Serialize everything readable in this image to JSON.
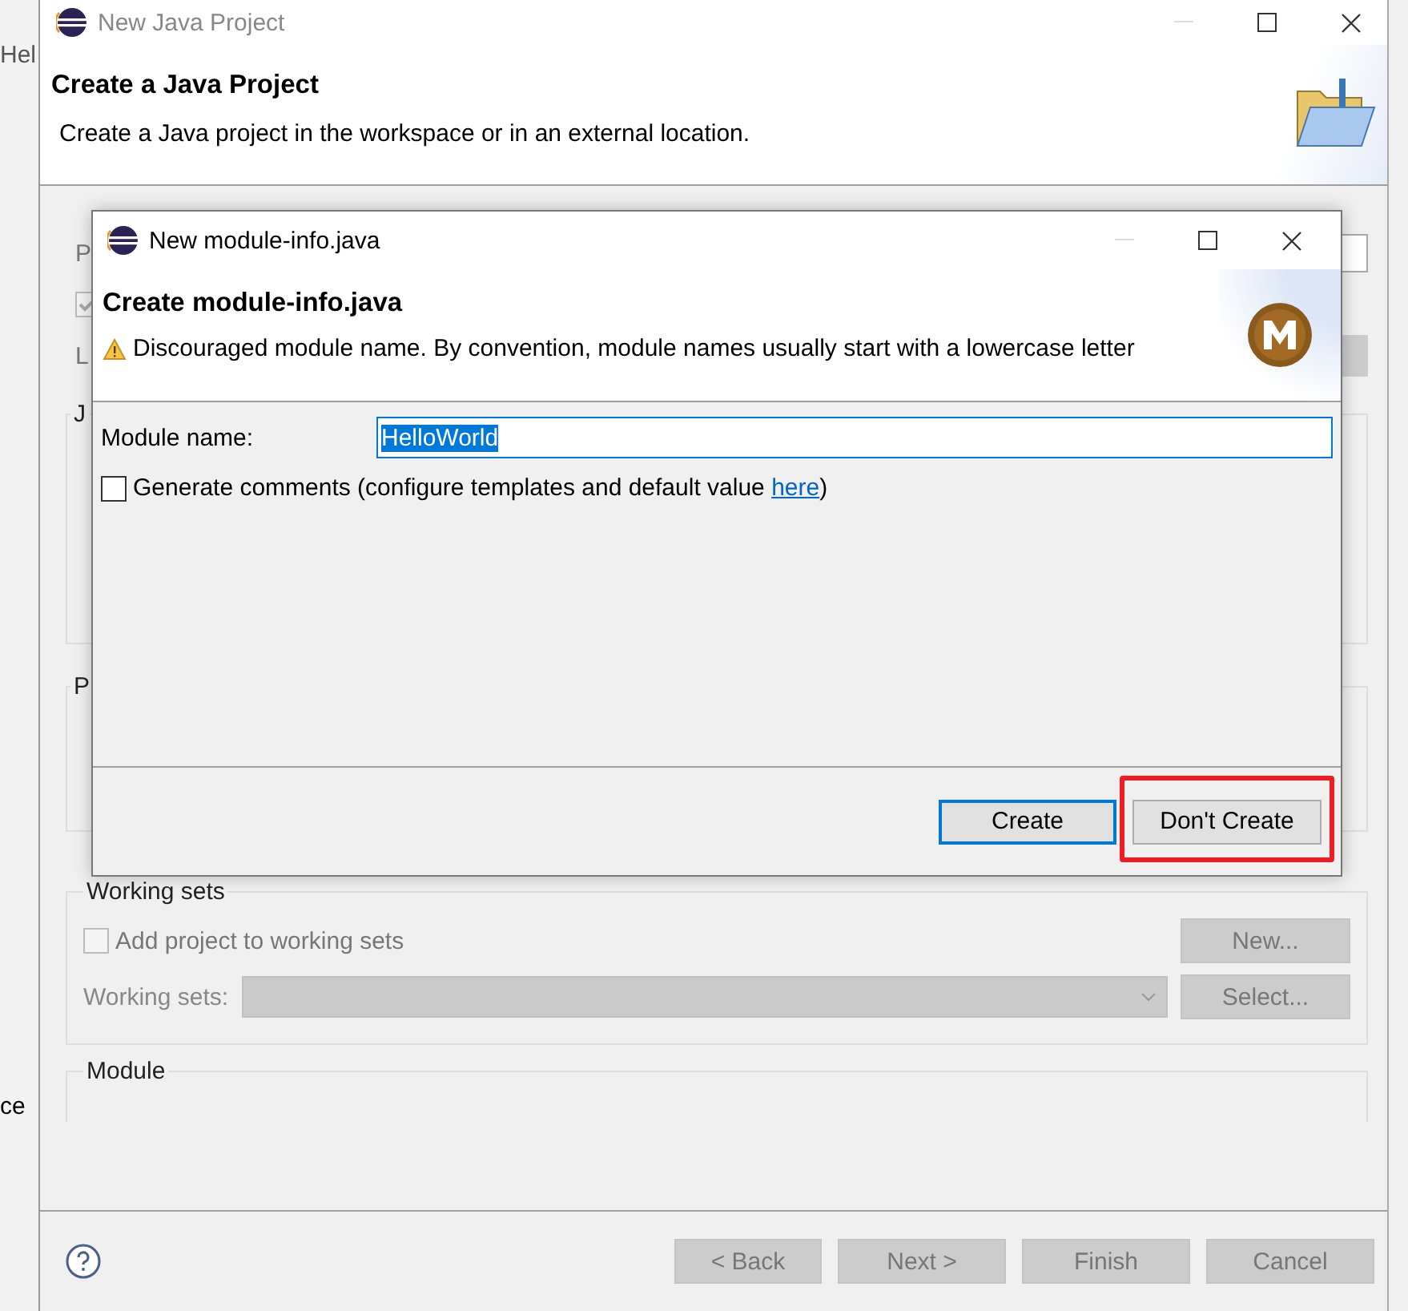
{
  "background": {
    "menu_fragment": "Hel",
    "side_fragment": "ce"
  },
  "window": {
    "title": "New Java Project",
    "heading": "Create a Java Project",
    "description": "Create a Java project in the workspace or in an external location."
  },
  "hidden_fragments": [
    "P",
    "L",
    "J",
    "P"
  ],
  "hidden_checkbox": {
    "checked": true,
    "disabled": true
  },
  "working_sets": {
    "title": "Working sets",
    "add_checkbox": {
      "label": "Add project to working sets",
      "checked": false,
      "disabled": true
    },
    "new_button": "New...",
    "sets_label": "Working sets:",
    "select_button": "Select..."
  },
  "module_group": {
    "title": "Module"
  },
  "footer": {
    "buttons": [
      {
        "label": "< Back",
        "disabled": true
      },
      {
        "label": "Next >",
        "disabled": true
      },
      {
        "label": "Finish",
        "disabled": true
      },
      {
        "label": "Cancel",
        "disabled": true
      }
    ]
  },
  "dialog": {
    "title": "New module-info.java",
    "heading": "Create module-info.java",
    "warning": "Discouraged module name. By convention, module names usually start with a lowercase letter",
    "module_name_label": "Module name:",
    "module_name": "HelloWorld",
    "generate_comments": {
      "label_before": "Generate comments (configure templates and default value ",
      "link": "here",
      "label_after": ")",
      "checked": false
    },
    "buttons": [
      {
        "label": "Create",
        "default": true,
        "highlighted": false
      },
      {
        "label": "Don't Create",
        "default": false,
        "highlighted": true
      }
    ]
  }
}
